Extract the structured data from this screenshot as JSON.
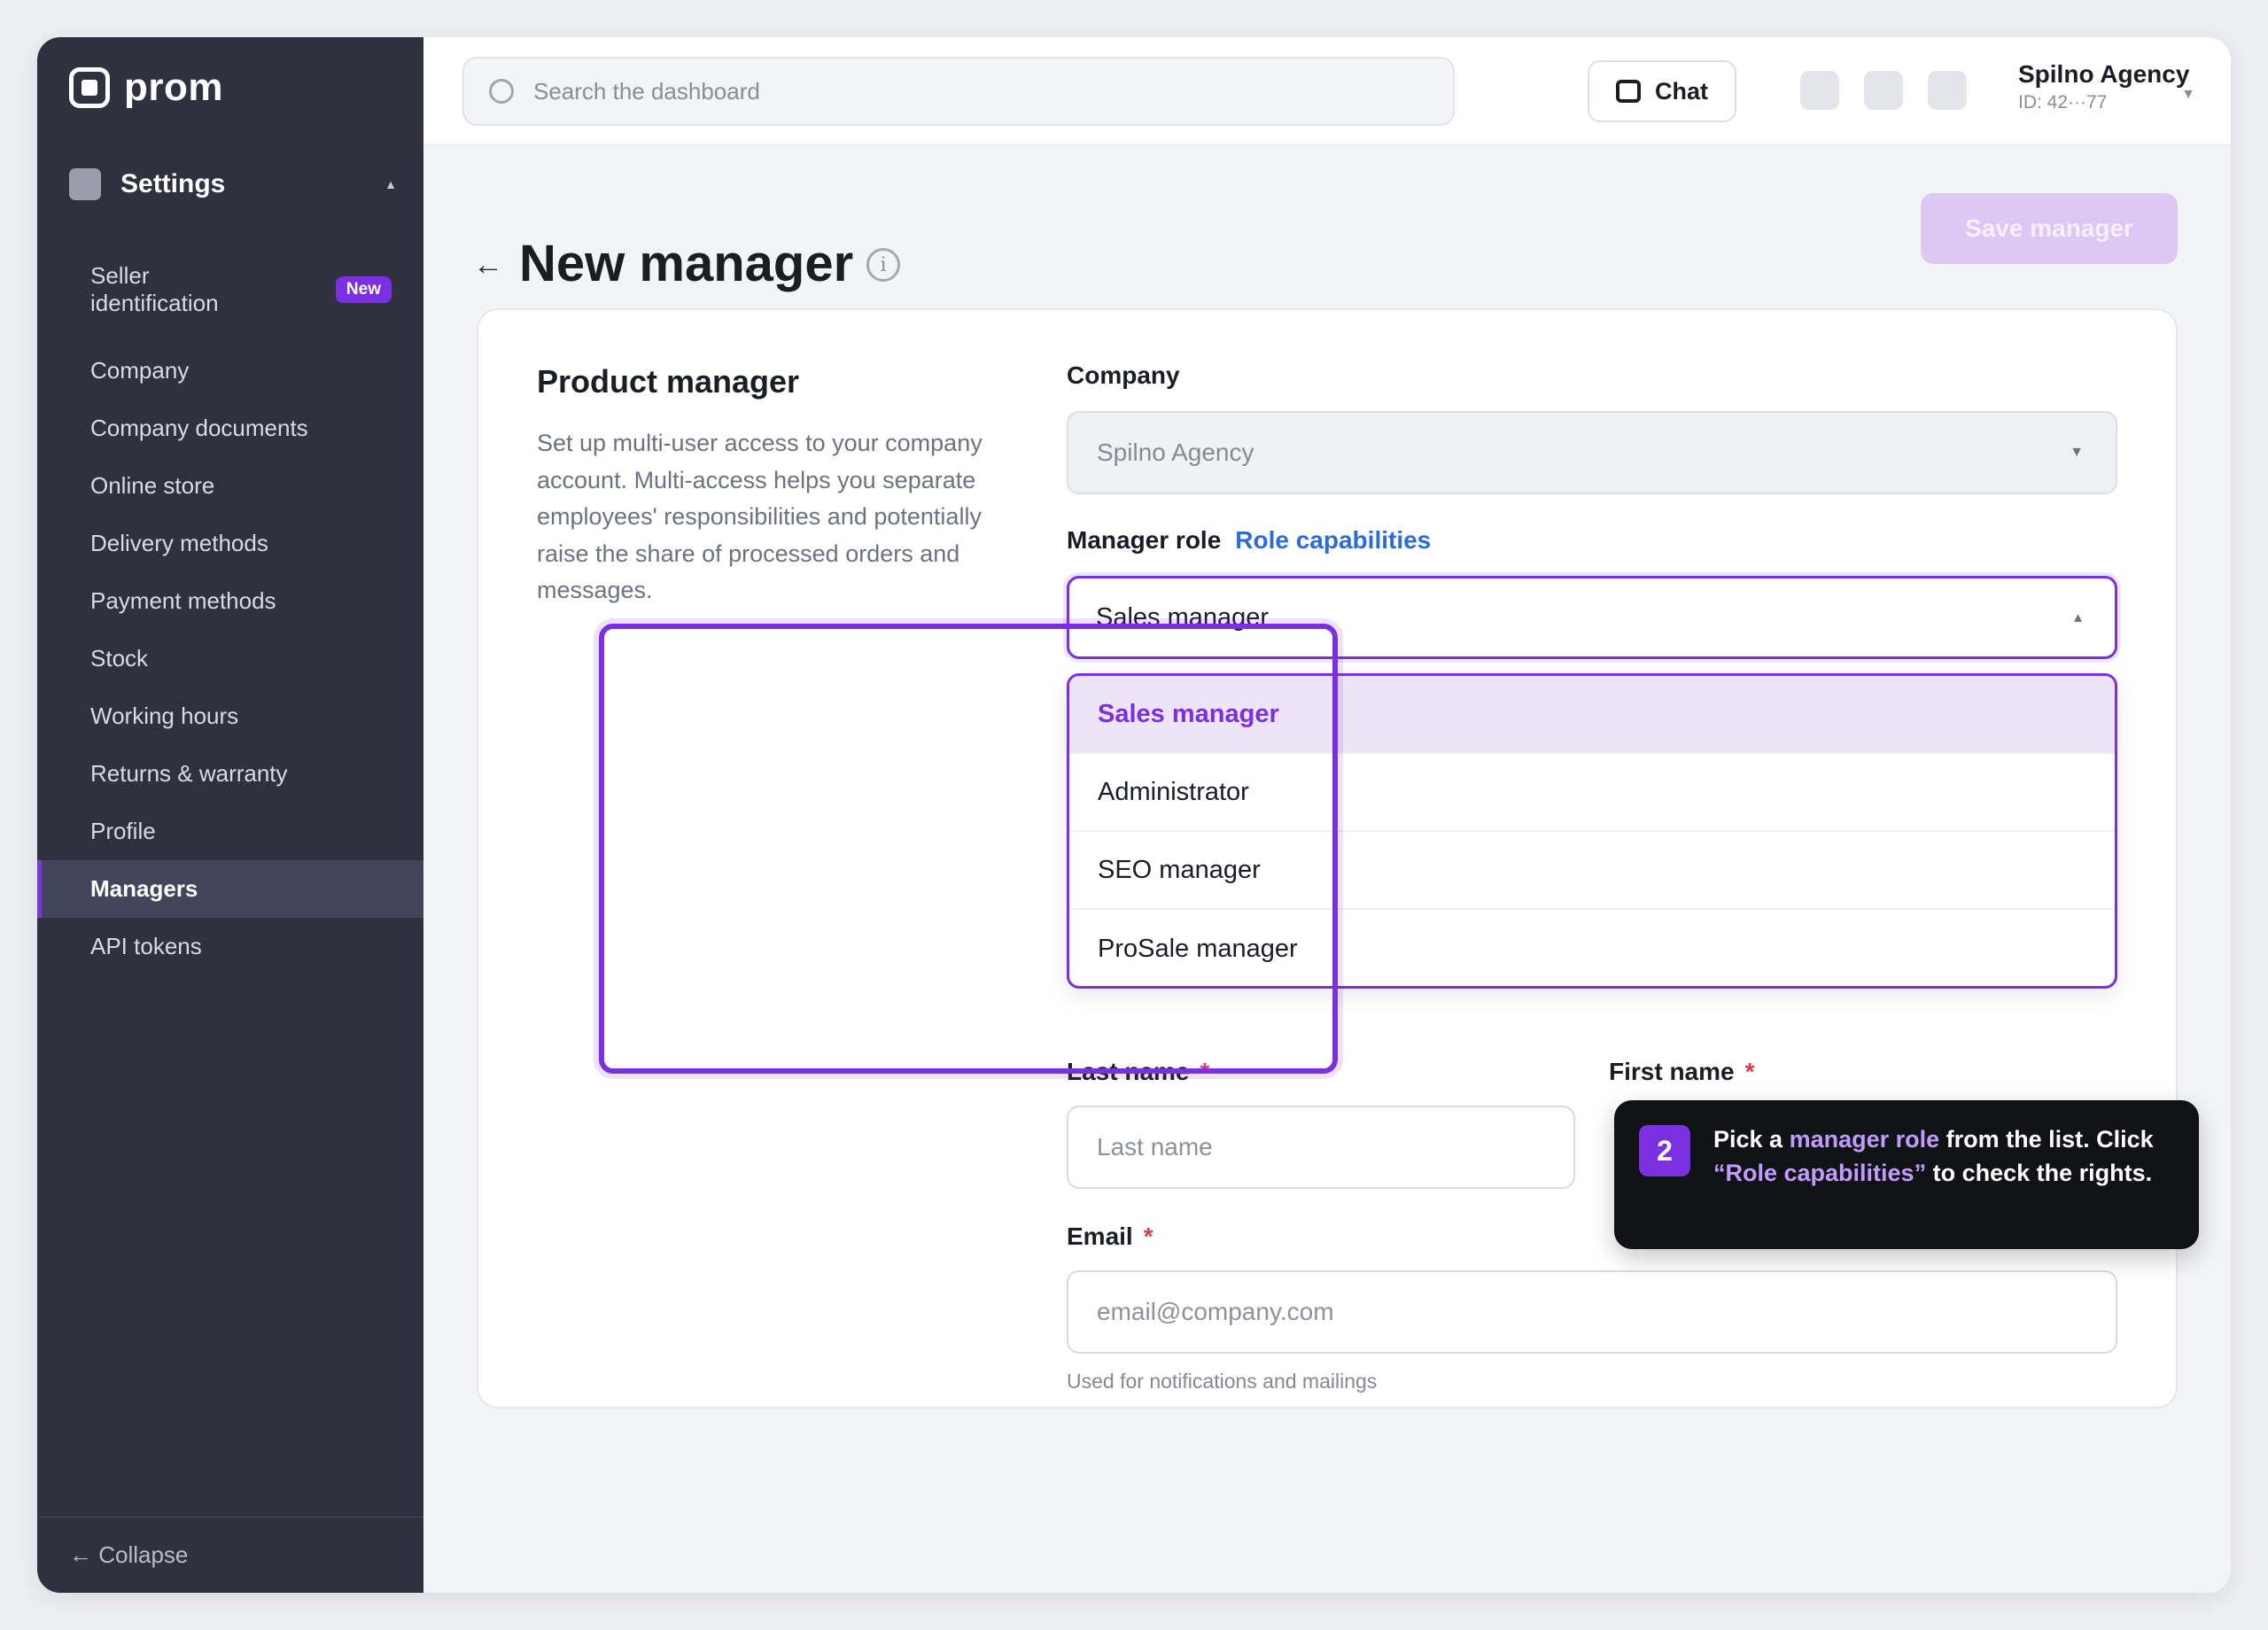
{
  "app": {
    "brand": "prom",
    "accent_color": "#7a2fe0",
    "sidebar_bg": "#2f313f"
  },
  "sidebar": {
    "section_title": "Settings",
    "items": [
      {
        "label": "Seller identification",
        "badge": "New"
      },
      {
        "label": "Company"
      },
      {
        "label": "Company documents"
      },
      {
        "label": "Online store"
      },
      {
        "label": "Delivery methods"
      },
      {
        "label": "Payment methods"
      },
      {
        "label": "Stock"
      },
      {
        "label": "Working hours"
      },
      {
        "label": "Returns & warranty"
      },
      {
        "label": "Profile"
      },
      {
        "label": "Managers",
        "active": true
      },
      {
        "label": "API tokens"
      }
    ],
    "collapse_label": "← Collapse"
  },
  "topbar": {
    "search_placeholder": "Search the dashboard",
    "chat_label": "Chat",
    "account_name": "Spilno Agency",
    "account_id": "ID: 42···77"
  },
  "page": {
    "title": "New manager",
    "save_label": "Save manager"
  },
  "form": {
    "section_title": "Product manager",
    "section_desc": "Set up multi-user access to your company account. Multi-access helps you separate employees' responsibilities and potentially raise the share of processed orders and messages.",
    "company_label": "Company",
    "company_value": "Spilno Agency",
    "role_label": "Manager role",
    "role_link": "Role capabilities",
    "role_value": "Sales manager",
    "role_options": [
      "Sales manager",
      "Administrator",
      "SEO manager",
      "ProSale manager"
    ],
    "last_name_label": "Last name",
    "last_name_placeholder": "Last name",
    "first_name_label": "First name",
    "email_label": "Email",
    "email_placeholder": "email@company.com",
    "email_hint": "Used for notifications and mailings",
    "required_mark": "*"
  },
  "tooltip": {
    "step": "2",
    "t1": "Pick a ",
    "t2": "manager role",
    "t3": " from the list. Click ",
    "t4": "“Role capabilities”",
    "t5": " to check the rights."
  }
}
